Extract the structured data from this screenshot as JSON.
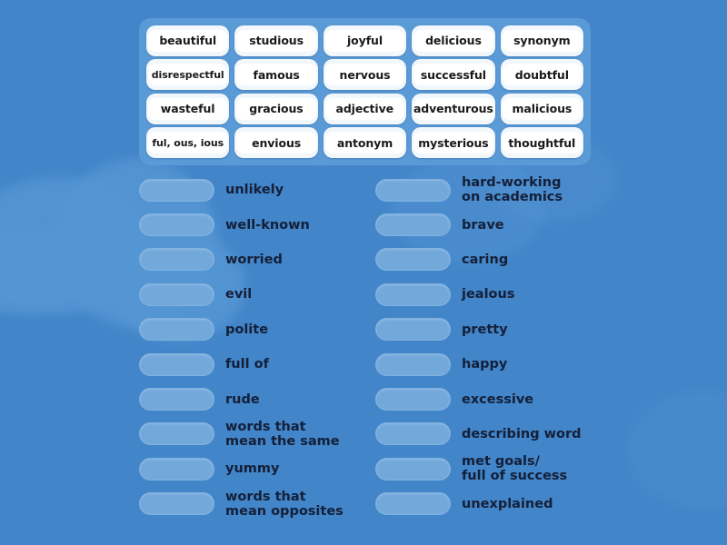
{
  "activity": {
    "type": "match-up",
    "background_color": "#4285c8",
    "panel_color": "#5a9ad6",
    "tile_color": "#ffffff",
    "drop_zone_color": "#73a8db",
    "text_color": "#141f38"
  },
  "word_bank": {
    "rows": [
      [
        {
          "label": "beautiful"
        },
        {
          "label": "studious"
        },
        {
          "label": "joyful"
        },
        {
          "label": "delicious"
        },
        {
          "label": "synonym"
        }
      ],
      [
        {
          "label": "disrespectful"
        },
        {
          "label": "famous"
        },
        {
          "label": "nervous"
        },
        {
          "label": "successful"
        },
        {
          "label": "doubtful"
        }
      ],
      [
        {
          "label": "wasteful"
        },
        {
          "label": "gracious"
        },
        {
          "label": "adjective"
        },
        {
          "label": "adventurous"
        },
        {
          "label": "malicious"
        }
      ],
      [
        {
          "label": "ful, ous, ious"
        },
        {
          "label": "envious"
        },
        {
          "label": "antonym"
        },
        {
          "label": "mysterious"
        },
        {
          "label": "thoughtful"
        }
      ]
    ]
  },
  "left_column": [
    {
      "definition": "unlikely"
    },
    {
      "definition": "well-known"
    },
    {
      "definition": "worried"
    },
    {
      "definition": "evil"
    },
    {
      "definition": "polite"
    },
    {
      "definition": "full of"
    },
    {
      "definition": "rude"
    },
    {
      "definition": "words that\nmean the same"
    },
    {
      "definition": "yummy"
    },
    {
      "definition": "words that\nmean opposites"
    }
  ],
  "right_column": [
    {
      "definition": "hard-working\non academics"
    },
    {
      "definition": "brave"
    },
    {
      "definition": "caring"
    },
    {
      "definition": "jealous"
    },
    {
      "definition": "pretty"
    },
    {
      "definition": "happy"
    },
    {
      "definition": "excessive"
    },
    {
      "definition": "describing word"
    },
    {
      "definition": "met goals/\nfull of success"
    },
    {
      "definition": "unexplained"
    }
  ]
}
